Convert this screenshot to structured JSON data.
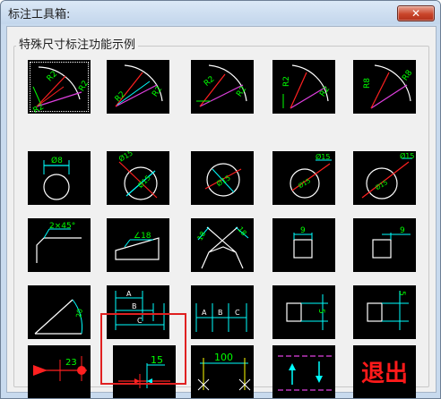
{
  "window": {
    "title": "标注工具箱:",
    "close_glyph": "✕"
  },
  "group": {
    "label": "特殊尺寸标注功能示例"
  },
  "tiles": {
    "r1c1": [
      "R2",
      "R2",
      "R2"
    ],
    "r1c2": [
      "R2",
      "R2"
    ],
    "r1c3": [
      "R2",
      "R2"
    ],
    "r1c4": [
      "R2",
      "R2"
    ],
    "r1c5": [
      "R8",
      "R8"
    ],
    "r2c1": [
      "Ø8"
    ],
    "r2c2": [
      "Ø15",
      "Ø15"
    ],
    "r2c3": [
      "Ø15"
    ],
    "r2c4": [
      "Ø15"
    ],
    "r2c5": [
      "Ø15"
    ],
    "r3c1": [
      "2×45°"
    ],
    "r3c2": [
      "∠18"
    ],
    "r3c3": [
      "18",
      "18"
    ],
    "r3c4": [
      "9"
    ],
    "r3c5": [
      "9"
    ],
    "r4c1": [
      "20"
    ],
    "r4c2": [
      "A",
      "B",
      "C"
    ],
    "r4c3": [
      "A",
      "B",
      "C"
    ],
    "r4c4": [
      "5"
    ],
    "r4c5": [
      "5"
    ],
    "r5c1": [
      "23"
    ],
    "r5c2": [
      "15"
    ],
    "r5c3": [
      "100"
    ],
    "r5c5": [
      "退出"
    ]
  }
}
